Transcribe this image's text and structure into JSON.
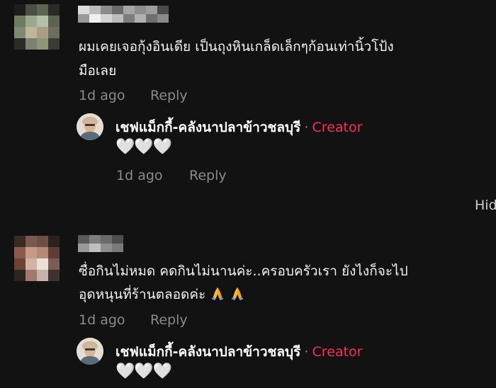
{
  "comments": [
    {
      "text_line1": "ผมเคยเจอกุ้งอินเดีย เป็นถุงหินเกล็ดเล็กๆก้อนเท่านิ้วโป้ง",
      "text_line2": "มือเลย",
      "time": "1d ago",
      "reply_label": "Reply",
      "reply": {
        "author": "เชฟแม็กกี้-คลังนาปลาข้าวชลบุรี",
        "separator": "·",
        "badge": "Creator",
        "text": "🤍🤍🤍",
        "time": "1d ago",
        "reply_label": "Reply"
      }
    },
    {
      "text_line1": "ซื่อกินไม่หมด คดกินไม่นานค่ะ..ครอบครัวเรา ยังไงก็จะไป",
      "text_line2": "อุดหนุนที่ร้านตลอดค่ะ",
      "emoji_icons": [
        "folded-hands-icon",
        "folded-hands-icon"
      ],
      "time": "1d ago",
      "reply_label": "Reply",
      "reply": {
        "author": "เชฟแม็กกี้-คลังนาปลาข้าวชลบุรี",
        "separator": "·",
        "badge": "Creator",
        "text": "🤍🤍🤍"
      }
    }
  ],
  "hide_label": "Hid",
  "colors": {
    "background": "#121212",
    "creator_badge": "#fe2c55",
    "meta_text": "#8a8a8a"
  }
}
